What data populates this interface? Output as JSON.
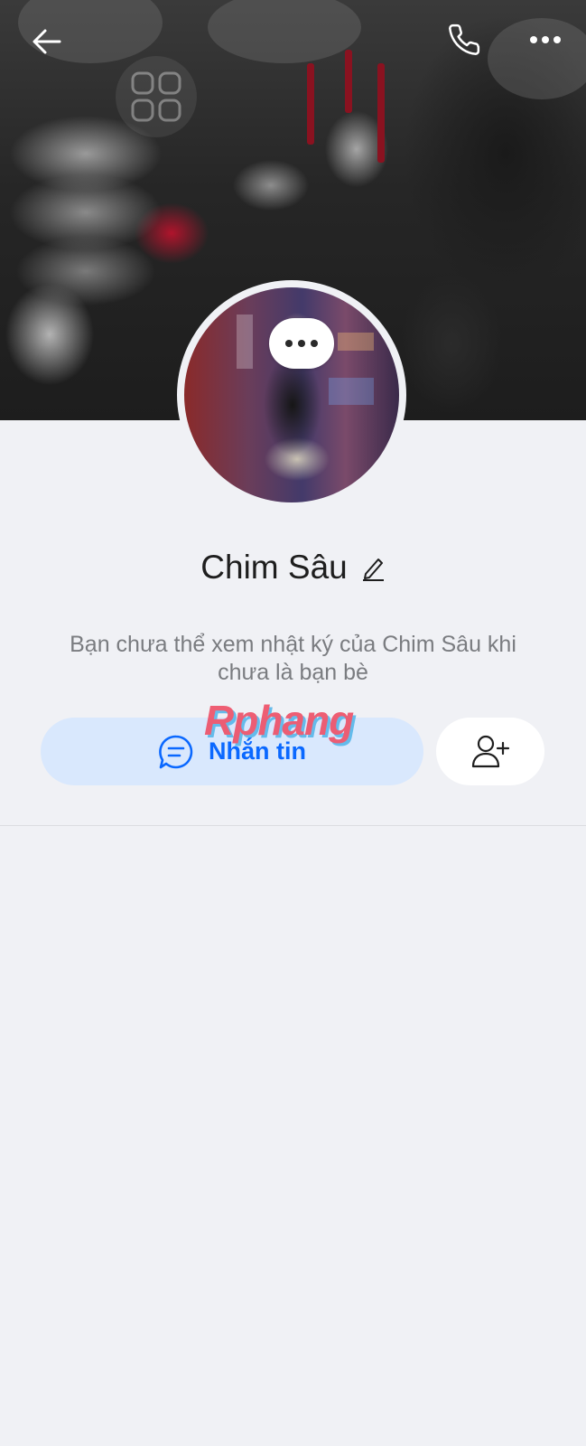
{
  "header": {
    "back_icon": "arrow-left-icon",
    "call_icon": "phone-icon",
    "more_icon": "more-horizontal-icon"
  },
  "cover": {
    "icon": "grid-icon"
  },
  "avatar": {
    "more_icon": "ellipsis-icon"
  },
  "profile": {
    "name": "Chim Sâu",
    "edit_icon": "pencil-icon",
    "notice": "Bạn chưa thể xem nhật ký của Chim Sâu khi chưa là bạn bè"
  },
  "actions": {
    "message_label": "Nhắn tin",
    "message_icon": "chat-bubble-icon",
    "add_friend_icon": "user-plus-icon"
  },
  "watermark": {
    "text": "Rphang"
  },
  "colors": {
    "accent": "#0a68ff",
    "message_button_bg": "#d9e8fd",
    "page_bg": "#f0f1f5"
  }
}
